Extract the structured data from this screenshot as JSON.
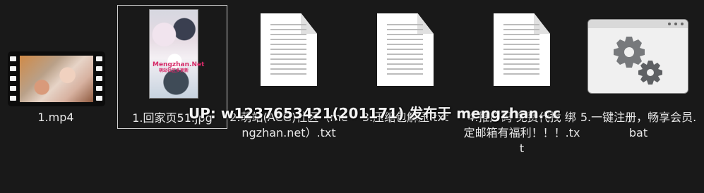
{
  "files": [
    {
      "name": "1.mp4",
      "type": "video",
      "icon": "video-file-icon"
    },
    {
      "name": "1.回家页51.jpg",
      "type": "image",
      "icon": "image-thumbnail-icon",
      "watermark": {
        "main": "Mengzhan.Net",
        "sub": "萌站社区多更新"
      }
    },
    {
      "name": "2.萌站(ACG)社区（mengzhan.net）.txt",
      "type": "text",
      "icon": "text-document-icon"
    },
    {
      "name": "3.压缩包解压.txt",
      "type": "text",
      "icon": "text-document-icon"
    },
    {
      "name": "4.推广码 免费代找 绑定邮箱有福利！！！.txt",
      "type": "text",
      "icon": "text-document-icon"
    },
    {
      "name": "5.一键注册，畅享会员.bat",
      "type": "batch",
      "icon": "settings-gears-icon"
    }
  ],
  "overlay": {
    "text": "UP: w1237653421(201171) 发布于 mengzhan.cc"
  },
  "colors": {
    "background": "#191919",
    "text": "#e8e8e8",
    "selection": "#cfcfcf"
  }
}
